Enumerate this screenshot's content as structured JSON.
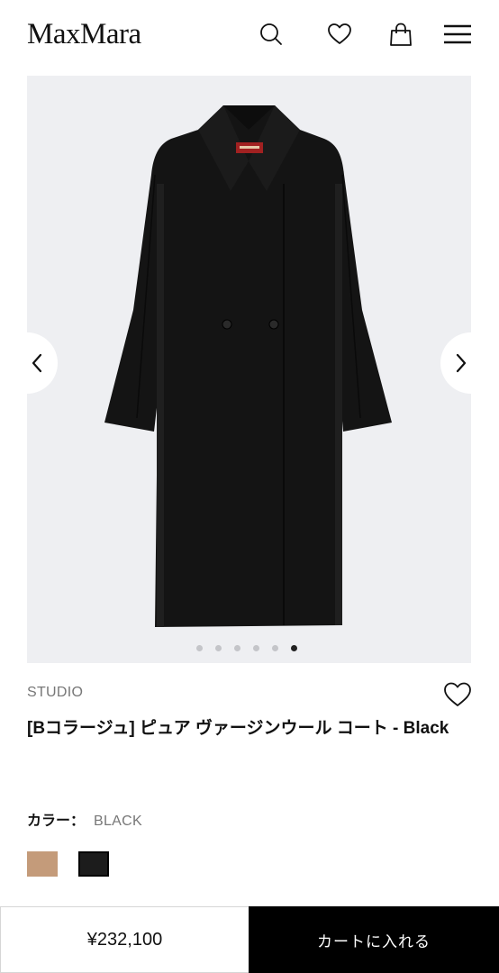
{
  "header": {
    "logo": "MaxMara",
    "icons": [
      "search-icon",
      "heart-icon",
      "shopping-bag-icon",
      "menu-icon"
    ]
  },
  "gallery": {
    "image_subject": "black double-breasted long coat",
    "slide_count": 6,
    "active_slide": 6
  },
  "product": {
    "brand_line": "STUDIO",
    "title": "[Bコラージュ] ピュア ヴァージンウール コート - Black",
    "color_label": "カラー：",
    "color_value": "BLACK",
    "swatches": [
      {
        "name": "camel",
        "color": "#c49b7a"
      },
      {
        "name": "black",
        "color": "#1c1c1c",
        "selected": true
      }
    ]
  },
  "footer": {
    "price": "¥232,100",
    "cart_label": "カートに入れる"
  },
  "colors": {
    "gallery_bg": "#eeeff2",
    "cart_bg": "#000000"
  }
}
